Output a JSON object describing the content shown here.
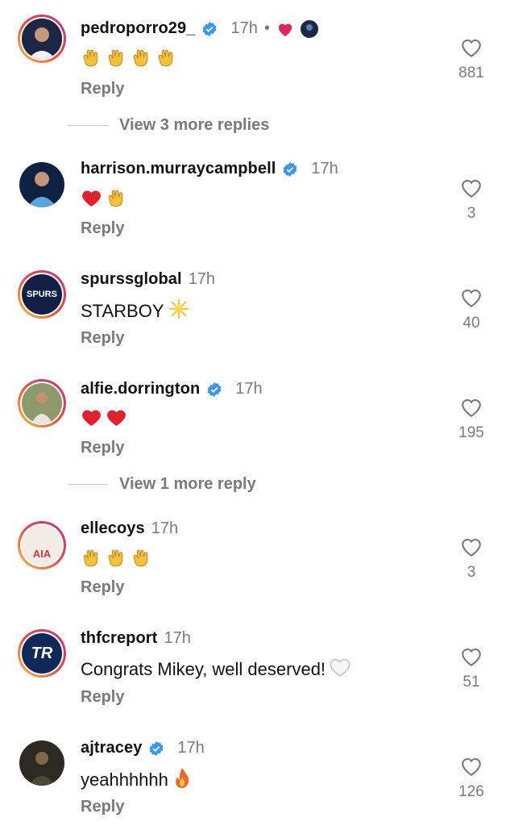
{
  "comments": [
    {
      "username": "pedroporro29_",
      "verified": true,
      "time": "17h",
      "text": "",
      "emoji": [
        "clap",
        "clap",
        "clap",
        "clap"
      ],
      "likes": "881",
      "reply": "Reply",
      "author_liked": true
    },
    {
      "username": "harrison.murraycampbell",
      "verified": true,
      "time": "17h",
      "text": "",
      "emoji": [
        "heart",
        "clap"
      ],
      "likes": "3",
      "reply": "Reply"
    },
    {
      "username": "spurssglobal",
      "verified": false,
      "time": "17h",
      "text": "STARBOY",
      "emoji": [
        "sparkle"
      ],
      "likes": "40",
      "reply": "Reply",
      "avatar_text": "SPURS"
    },
    {
      "username": "alfie.dorrington",
      "verified": true,
      "time": "17h",
      "text": "",
      "emoji": [
        "heart",
        "heart"
      ],
      "likes": "195",
      "reply": "Reply"
    },
    {
      "username": "ellecoys",
      "verified": false,
      "time": "17h",
      "text": "",
      "emoji": [
        "clap",
        "clap",
        "clap"
      ],
      "likes": "3",
      "reply": "Reply",
      "avatar_text": "AIA"
    },
    {
      "username": "thfcreport",
      "verified": false,
      "time": "17h",
      "text": "Congrats Mikey, well deserved!",
      "emoji": [
        "white-heart"
      ],
      "likes": "51",
      "reply": "Reply",
      "avatar_text": "TR"
    },
    {
      "username": "ajtracey",
      "verified": true,
      "time": "17h",
      "text": "yeahhhhhh",
      "emoji": [
        "fire"
      ],
      "likes": "126",
      "reply": "Reply"
    }
  ],
  "view_more": [
    {
      "label": "View 3 more replies"
    },
    {
      "label": "View 1 more reply"
    }
  ],
  "colors": {
    "verified": "#3897f0",
    "muted": "#7a7a7a",
    "ring": "#e1306c"
  }
}
